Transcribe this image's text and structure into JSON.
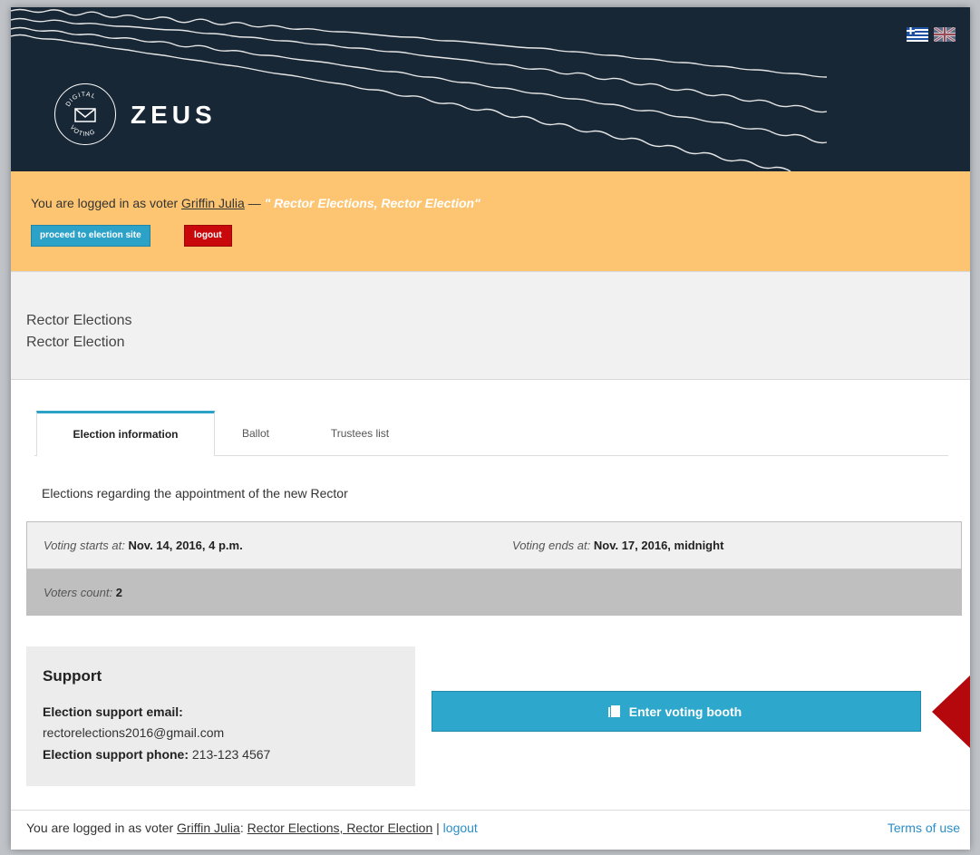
{
  "header": {
    "logo_small_text_top": "DIGITAL",
    "logo_small_text_bottom": "VOTING",
    "logo_text": "ZEUS",
    "languages": [
      "greek-flag",
      "uk-flag"
    ]
  },
  "banner": {
    "prefix": "You are logged in as voter ",
    "voter_name": "Griffin Julia",
    "separator": " — ",
    "election": "\" Rector Elections, Rector Election\"",
    "proceed_label": "proceed to election site",
    "logout_label": "logout"
  },
  "title": {
    "line1": "Rector Elections",
    "line2": "Rector Election"
  },
  "tabs": [
    {
      "label": "Election information",
      "active": true
    },
    {
      "label": "Ballot",
      "active": false
    },
    {
      "label": "Trustees list",
      "active": false
    }
  ],
  "description": "Elections regarding the appointment of the new Rector",
  "info": {
    "start_label": "Voting starts at:",
    "start_value": "Nov. 14, 2016, 4 p.m.",
    "end_label": "Voting ends at:",
    "end_value": "Nov. 17, 2016, midnight",
    "voters_label": "Voters count:",
    "voters_value": "2"
  },
  "support": {
    "heading": "Support",
    "email_label": "Election support email:",
    "email_value": "rectorelections2016@gmail.com",
    "phone_label": "Election support phone:",
    "phone_value": "213-123 4567"
  },
  "vote_button": {
    "label": "Enter voting booth",
    "icon": "booth-icon"
  },
  "footer": {
    "prefix": "You are logged in as voter ",
    "voter_name": "Griffin Julia",
    "colon": ": ",
    "election": "Rector Elections, Rector Election",
    "pipe": " | ",
    "logout": "logout",
    "terms": "Terms of use"
  },
  "colors": {
    "header_bg": "#182736",
    "banner_bg": "#fdc571",
    "accent": "#2da2c8",
    "danger": "#c9080c",
    "arrow": "#b5080c"
  }
}
